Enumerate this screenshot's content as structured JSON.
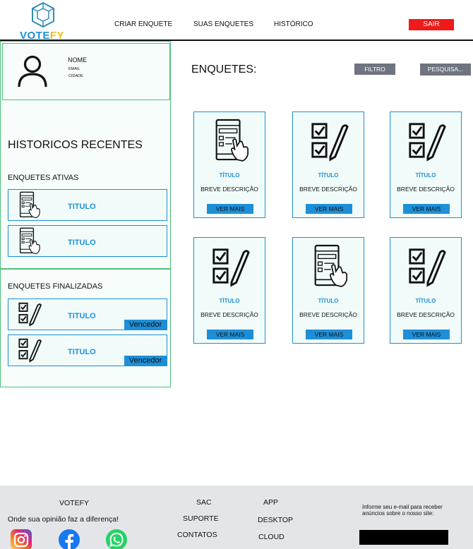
{
  "header": {
    "logo_text_v": "V",
    "logo_text_rest": "OTE",
    "logo_text_fy": "FY",
    "nav": [
      "CRIAR ENQUETE",
      "SUAS ENQUETES",
      "HISTÓRICO"
    ],
    "logout_label": "SAIR"
  },
  "sidebar": {
    "profile": {
      "name": "NOME",
      "email": "EMAIL",
      "city": "CIDADE"
    },
    "recent_title": "HISTORICOS RECENTES",
    "active_title": "ENQUETES ATIVAS",
    "active_items": [
      {
        "title": "TITULO",
        "icon": "tablet-form-icon"
      },
      {
        "title": "TITULO",
        "icon": "tablet-form-icon"
      }
    ],
    "finished_title": "ENQUETES FINALIZADAS",
    "finished_items": [
      {
        "title": "TITULO",
        "badge": "Vencedor",
        "icon": "checklist-pen-icon"
      },
      {
        "title": "TITULO",
        "badge": "Vencedor",
        "icon": "checklist-pen-icon"
      }
    ]
  },
  "main": {
    "title": "ENQUETES:",
    "filter_label": "FILTRO",
    "search_label": "PESQUISA...",
    "cards": [
      {
        "icon": "tablet-form-icon",
        "title": "TÍTULO",
        "desc": "BREVE DESCRIÇÃO",
        "button": "VER MAIS"
      },
      {
        "icon": "checklist-pen-icon",
        "title": "TÍTULO",
        "desc": "BREVE DESCRIÇÃO",
        "button": "VER MAIS"
      },
      {
        "icon": "checklist-pen-icon",
        "title": "TÍTULO",
        "desc": "BREVE DESCRIÇÃO",
        "button": "VER MAIS"
      },
      {
        "icon": "checklist-pen-icon",
        "title": "TÍTULO",
        "desc": "BREVE DESCRIÇÃO",
        "button": "VER MAIS"
      },
      {
        "icon": "tablet-form-icon",
        "title": "TÍTULO",
        "desc": "BREVE DESCRIÇÃO",
        "button": "VER MAIS"
      },
      {
        "icon": "checklist-pen-icon",
        "title": "TÍTULO",
        "desc": "BREVE DESCRIÇÃO",
        "button": "VER MAIS"
      }
    ]
  },
  "footer": {
    "brand": "VOTEFY",
    "slogan": "Onde sua opinião faz a diferença!",
    "col1": [
      "SAC",
      "SUPORTE",
      "CONTATOS"
    ],
    "col2": [
      "APP",
      "DESKTOP",
      "CLOUD"
    ],
    "newsletter_label": "Informe seu e-mail para receber anúncios sobre o nosso site:",
    "newsletter_value": "",
    "social": [
      "instagram-icon",
      "facebook-icon",
      "whatsapp-icon"
    ]
  },
  "colors": {
    "accent_blue": "#1d8fd8",
    "logout_red": "#f01a1a",
    "border_green": "#4fbf7f",
    "card_bg": "#f1fcfa",
    "footer_bg": "#e3e5e8",
    "button_gray": "#6e7480"
  }
}
